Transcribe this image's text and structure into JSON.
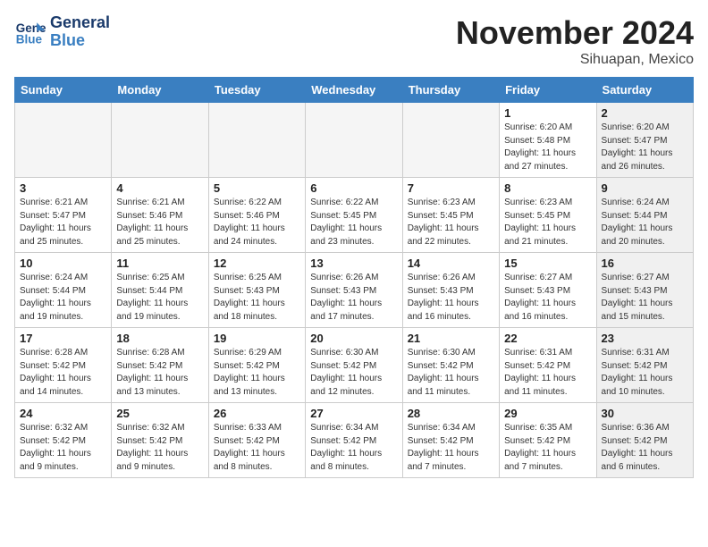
{
  "header": {
    "logo_line1": "General",
    "logo_line2": "Blue",
    "month": "November 2024",
    "location": "Sihuapan, Mexico"
  },
  "weekdays": [
    "Sunday",
    "Monday",
    "Tuesday",
    "Wednesday",
    "Thursday",
    "Friday",
    "Saturday"
  ],
  "weeks": [
    [
      {
        "day": "",
        "info": "",
        "empty": true
      },
      {
        "day": "",
        "info": "",
        "empty": true
      },
      {
        "day": "",
        "info": "",
        "empty": true
      },
      {
        "day": "",
        "info": "",
        "empty": true
      },
      {
        "day": "",
        "info": "",
        "empty": true
      },
      {
        "day": "1",
        "info": "Sunrise: 6:20 AM\nSunset: 5:48 PM\nDaylight: 11 hours\nand 27 minutes.",
        "shaded": false
      },
      {
        "day": "2",
        "info": "Sunrise: 6:20 AM\nSunset: 5:47 PM\nDaylight: 11 hours\nand 26 minutes.",
        "shaded": true
      }
    ],
    [
      {
        "day": "3",
        "info": "Sunrise: 6:21 AM\nSunset: 5:47 PM\nDaylight: 11 hours\nand 25 minutes.",
        "shaded": false
      },
      {
        "day": "4",
        "info": "Sunrise: 6:21 AM\nSunset: 5:46 PM\nDaylight: 11 hours\nand 25 minutes.",
        "shaded": false
      },
      {
        "day": "5",
        "info": "Sunrise: 6:22 AM\nSunset: 5:46 PM\nDaylight: 11 hours\nand 24 minutes.",
        "shaded": false
      },
      {
        "day": "6",
        "info": "Sunrise: 6:22 AM\nSunset: 5:45 PM\nDaylight: 11 hours\nand 23 minutes.",
        "shaded": false
      },
      {
        "day": "7",
        "info": "Sunrise: 6:23 AM\nSunset: 5:45 PM\nDaylight: 11 hours\nand 22 minutes.",
        "shaded": false
      },
      {
        "day": "8",
        "info": "Sunrise: 6:23 AM\nSunset: 5:45 PM\nDaylight: 11 hours\nand 21 minutes.",
        "shaded": false
      },
      {
        "day": "9",
        "info": "Sunrise: 6:24 AM\nSunset: 5:44 PM\nDaylight: 11 hours\nand 20 minutes.",
        "shaded": true
      }
    ],
    [
      {
        "day": "10",
        "info": "Sunrise: 6:24 AM\nSunset: 5:44 PM\nDaylight: 11 hours\nand 19 minutes.",
        "shaded": false
      },
      {
        "day": "11",
        "info": "Sunrise: 6:25 AM\nSunset: 5:44 PM\nDaylight: 11 hours\nand 19 minutes.",
        "shaded": false
      },
      {
        "day": "12",
        "info": "Sunrise: 6:25 AM\nSunset: 5:43 PM\nDaylight: 11 hours\nand 18 minutes.",
        "shaded": false
      },
      {
        "day": "13",
        "info": "Sunrise: 6:26 AM\nSunset: 5:43 PM\nDaylight: 11 hours\nand 17 minutes.",
        "shaded": false
      },
      {
        "day": "14",
        "info": "Sunrise: 6:26 AM\nSunset: 5:43 PM\nDaylight: 11 hours\nand 16 minutes.",
        "shaded": false
      },
      {
        "day": "15",
        "info": "Sunrise: 6:27 AM\nSunset: 5:43 PM\nDaylight: 11 hours\nand 16 minutes.",
        "shaded": false
      },
      {
        "day": "16",
        "info": "Sunrise: 6:27 AM\nSunset: 5:43 PM\nDaylight: 11 hours\nand 15 minutes.",
        "shaded": true
      }
    ],
    [
      {
        "day": "17",
        "info": "Sunrise: 6:28 AM\nSunset: 5:42 PM\nDaylight: 11 hours\nand 14 minutes.",
        "shaded": false
      },
      {
        "day": "18",
        "info": "Sunrise: 6:28 AM\nSunset: 5:42 PM\nDaylight: 11 hours\nand 13 minutes.",
        "shaded": false
      },
      {
        "day": "19",
        "info": "Sunrise: 6:29 AM\nSunset: 5:42 PM\nDaylight: 11 hours\nand 13 minutes.",
        "shaded": false
      },
      {
        "day": "20",
        "info": "Sunrise: 6:30 AM\nSunset: 5:42 PM\nDaylight: 11 hours\nand 12 minutes.",
        "shaded": false
      },
      {
        "day": "21",
        "info": "Sunrise: 6:30 AM\nSunset: 5:42 PM\nDaylight: 11 hours\nand 11 minutes.",
        "shaded": false
      },
      {
        "day": "22",
        "info": "Sunrise: 6:31 AM\nSunset: 5:42 PM\nDaylight: 11 hours\nand 11 minutes.",
        "shaded": false
      },
      {
        "day": "23",
        "info": "Sunrise: 6:31 AM\nSunset: 5:42 PM\nDaylight: 11 hours\nand 10 minutes.",
        "shaded": true
      }
    ],
    [
      {
        "day": "24",
        "info": "Sunrise: 6:32 AM\nSunset: 5:42 PM\nDaylight: 11 hours\nand 9 minutes.",
        "shaded": false
      },
      {
        "day": "25",
        "info": "Sunrise: 6:32 AM\nSunset: 5:42 PM\nDaylight: 11 hours\nand 9 minutes.",
        "shaded": false
      },
      {
        "day": "26",
        "info": "Sunrise: 6:33 AM\nSunset: 5:42 PM\nDaylight: 11 hours\nand 8 minutes.",
        "shaded": false
      },
      {
        "day": "27",
        "info": "Sunrise: 6:34 AM\nSunset: 5:42 PM\nDaylight: 11 hours\nand 8 minutes.",
        "shaded": false
      },
      {
        "day": "28",
        "info": "Sunrise: 6:34 AM\nSunset: 5:42 PM\nDaylight: 11 hours\nand 7 minutes.",
        "shaded": false
      },
      {
        "day": "29",
        "info": "Sunrise: 6:35 AM\nSunset: 5:42 PM\nDaylight: 11 hours\nand 7 minutes.",
        "shaded": false
      },
      {
        "day": "30",
        "info": "Sunrise: 6:36 AM\nSunset: 5:42 PM\nDaylight: 11 hours\nand 6 minutes.",
        "shaded": true
      }
    ]
  ]
}
